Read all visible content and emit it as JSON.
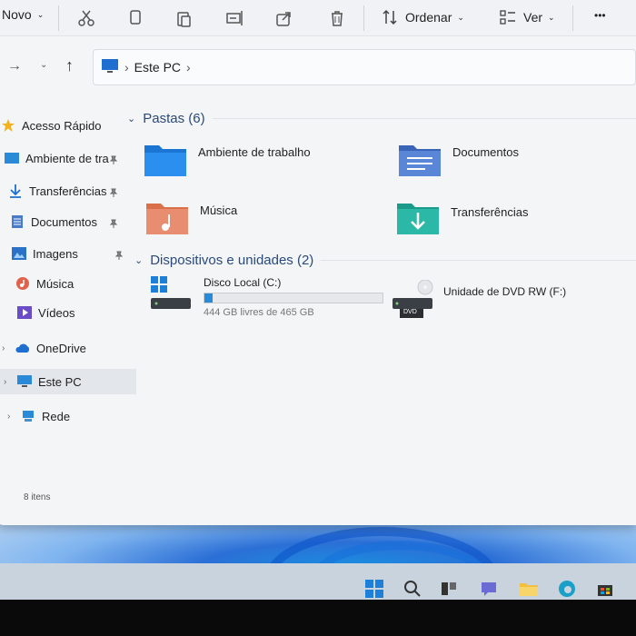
{
  "toolbar": {
    "new_label": "Novo",
    "sort_label": "Ordenar",
    "view_label": "Ver",
    "more_label": "•••"
  },
  "address": {
    "path": [
      "Este PC"
    ]
  },
  "sidebar": {
    "items": [
      {
        "label": "Acesso Rápido",
        "icon": "star-icon"
      },
      {
        "label": "Ambiente de tra",
        "icon": "desktop-icon",
        "pinned": true
      },
      {
        "label": "Transferências",
        "icon": "download-icon",
        "pinned": true
      },
      {
        "label": "Documentos",
        "icon": "documents-icon",
        "pinned": true
      },
      {
        "label": "Imagens",
        "icon": "pictures-icon",
        "pinned": true
      },
      {
        "label": "Música",
        "icon": "music-icon"
      },
      {
        "label": "Vídeos",
        "icon": "videos-icon"
      },
      {
        "label": "OneDrive",
        "icon": "cloud-icon"
      },
      {
        "label": "Este PC",
        "icon": "pc-icon"
      },
      {
        "label": "Rede",
        "icon": "network-icon"
      }
    ],
    "status": "8 itens"
  },
  "main": {
    "folders_header": "Pastas (6)",
    "folders": [
      {
        "label": "Ambiente de trabalho",
        "icon": "desktop-folder-icon"
      },
      {
        "label": "Documentos",
        "icon": "documents-folder-icon"
      },
      {
        "label": "Música",
        "icon": "music-folder-icon"
      },
      {
        "label": "Transferências",
        "icon": "downloads-folder-icon"
      }
    ],
    "devices_header": "Dispositivos e unidades (2)",
    "drives": [
      {
        "label": "Disco Local (C:)",
        "free_text": "444 GB livres de 465 GB",
        "used_fraction": 0.045,
        "icon": "local-disk-icon"
      },
      {
        "label": "Unidade de DVD RW (F:)",
        "icon": "dvd-drive-icon",
        "badge": "DVD"
      }
    ]
  },
  "colors": {
    "accent": "#2a8ad8",
    "header_text": "#2a4a7a",
    "window_bg": "#f4f5f7"
  }
}
